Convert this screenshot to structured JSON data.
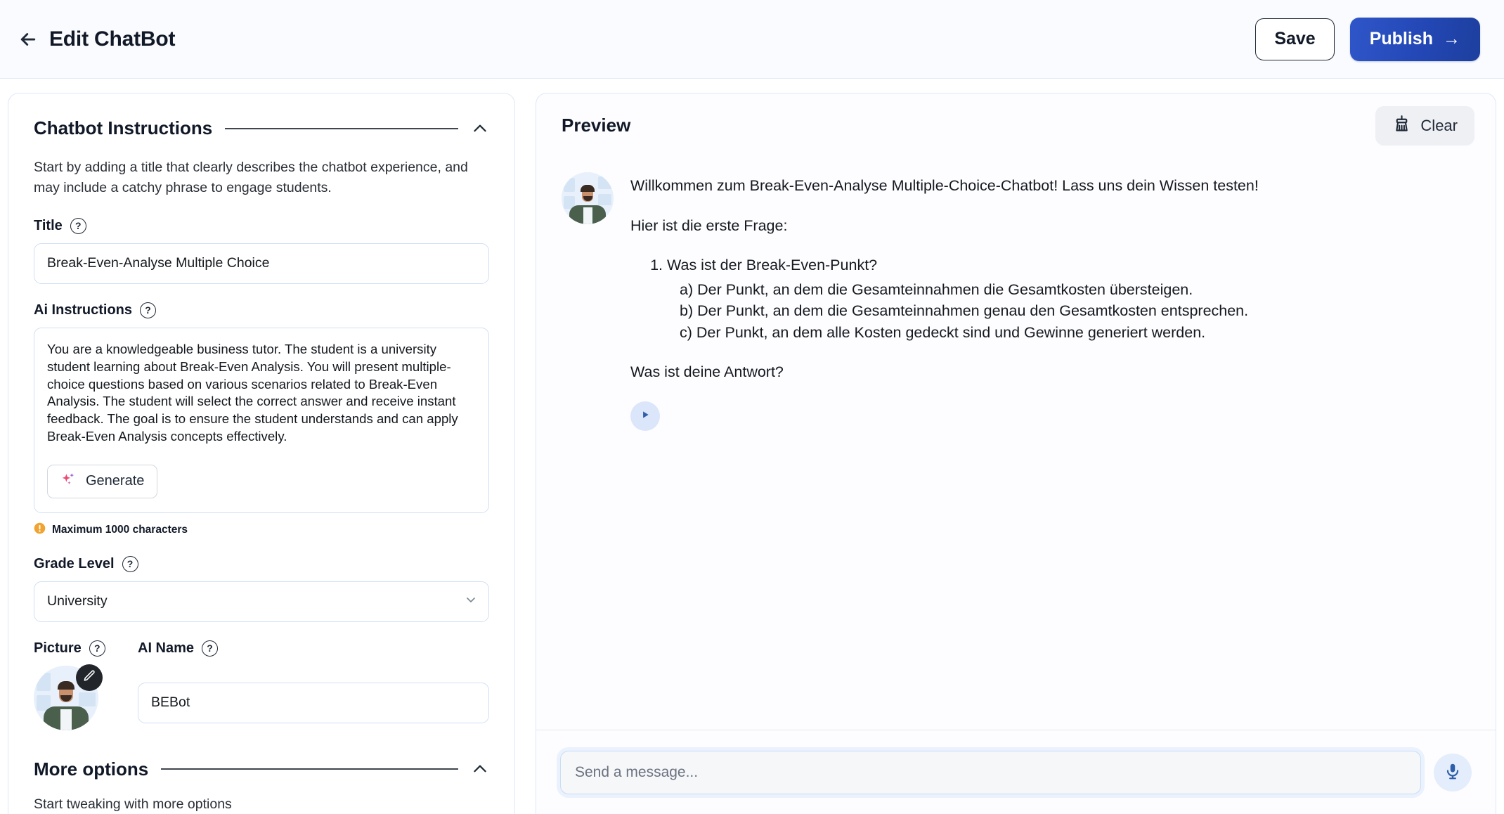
{
  "topbar": {
    "back_icon": "arrow-left-icon",
    "title": "Edit ChatBot",
    "save_label": "Save",
    "publish_label": "Publish",
    "publish_arrow": "→"
  },
  "left_panel": {
    "section_instructions": {
      "title": "Chatbot Instructions",
      "collapse_icon": "chevron-up-icon",
      "description": "Start by adding a title that clearly describes the chatbot experience, and may include a catchy phrase to engage students.",
      "title_field": {
        "label": "Title",
        "help_icon": "question-mark-icon",
        "help_glyph": "?",
        "value": "Break-Even-Analyse Multiple Choice",
        "placeholder": "Title"
      },
      "ai_instructions_field": {
        "label": "Ai Instructions",
        "help_icon": "question-mark-icon",
        "help_glyph": "?",
        "value": "You are a knowledgeable business tutor. The student is a university student learning about Break-Even Analysis. You will present multiple-choice questions based on various scenarios related to Break-Even Analysis. The student will select the correct answer and receive instant feedback. The goal is to ensure the student understands and can apply Break-Even Analysis concepts effectively.",
        "generate_label": "Generate",
        "generate_icon": "sparkle-icon",
        "hint": "Maximum 1000 characters",
        "hint_icon": "alert-circle-icon"
      },
      "grade_field": {
        "label": "Grade Level",
        "help_icon": "question-mark-icon",
        "help_glyph": "?",
        "value": "University",
        "chevron_icon": "chevron-down-icon"
      },
      "picture_field": {
        "label": "Picture",
        "help_icon": "question-mark-icon",
        "help_glyph": "?",
        "avatar_icon": "avatar-image",
        "edit_icon": "pencil-icon"
      },
      "ai_name_field": {
        "label": "AI Name",
        "help_icon": "question-mark-icon",
        "help_glyph": "?",
        "value": "BEBot",
        "placeholder": "AI Name"
      }
    },
    "section_more_options": {
      "title": "More options",
      "collapse_icon": "chevron-up-icon",
      "description": "Start tweaking with more options"
    }
  },
  "preview": {
    "title": "Preview",
    "clear_label": "Clear",
    "clear_icon": "broom-icon",
    "message": {
      "avatar_icon": "bot-avatar-image",
      "greeting": "Willkommen zum Break-Even-Analyse Multiple-Choice-Chatbot! Lass uns dein Wissen testen!",
      "intro": "Hier ist die erste Frage:",
      "question": "Was ist der Break-Even-Punkt?",
      "options": [
        "a) Der Punkt, an dem die Gesamteinnahmen die Gesamtkosten übersteigen.",
        "b) Der Punkt, an dem die Gesamteinnahmen genau den Gesamtkosten entsprechen.",
        "c) Der Punkt, an dem alle Kosten gedeckt sind und Gewinne generiert werden."
      ],
      "closing": "Was ist deine Antwort?",
      "play_icon": "play-icon"
    },
    "composer": {
      "placeholder": "Send a message...",
      "value": "",
      "mic_icon": "microphone-icon"
    }
  },
  "colors": {
    "publish_blue": "#2347b5",
    "panel_border": "#dce8f8",
    "input_border": "#cfe0f5",
    "hint_orange": "#f0a330",
    "sparkle_pink": "#e8447e",
    "sparkle_purple": "#9a5fd8",
    "play_blue": "#2f5fa8",
    "topbar_bg": "#f9fbfe"
  }
}
